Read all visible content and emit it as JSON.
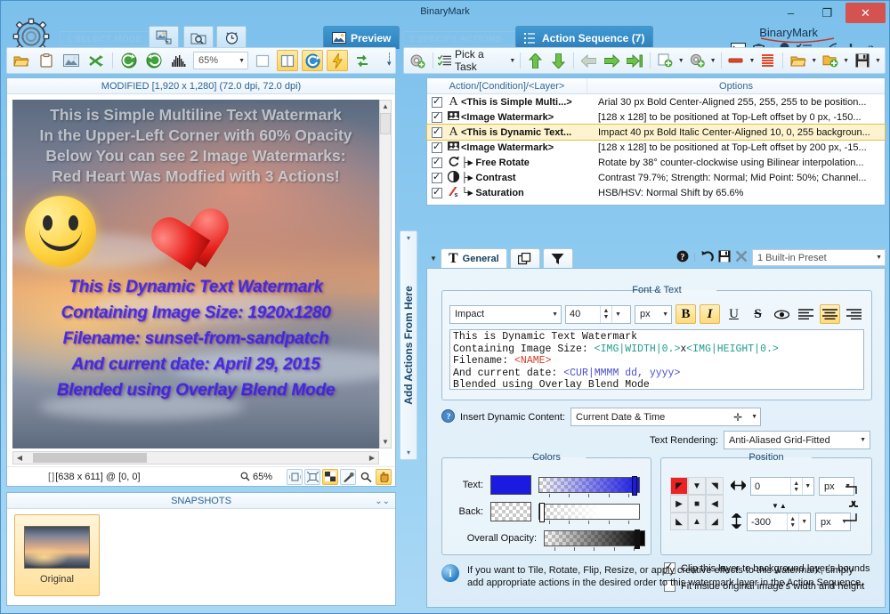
{
  "window": {
    "title": "BinaryMark",
    "brand": "BinaryMark",
    "minimize": "–",
    "maximize": "❐",
    "close": "✕"
  },
  "modebar": {
    "step1_label": "1 SELECT MODE",
    "step2_label": "2 SPECIFY ACTIONS",
    "mode_buttons": [
      {
        "name": "batch-images-mode",
        "icon": "batch-images-icon"
      },
      {
        "name": "folder-watch-mode",
        "icon": "folder-search-icon"
      },
      {
        "name": "scheduler-mode",
        "icon": "alarm-clock-icon"
      }
    ],
    "tabs": [
      {
        "label": "Preview",
        "icon": "picture-icon",
        "active": true
      },
      {
        "label": "Action Sequence (7)",
        "icon": "sequence-icon",
        "active": true
      }
    ],
    "right_icons": [
      "console-icon",
      "shield-icon",
      "lightbulb-icon",
      "checklist-icon",
      "wifi-icon",
      "plus-icon",
      "help-icon"
    ]
  },
  "left_toolbar": {
    "icons": [
      "open-folder-icon",
      "clipboard-icon",
      "image-icon",
      "shuffle-icon",
      "back-icon",
      "forward-icon",
      "histogram-icon"
    ],
    "zoom_value": "65%",
    "right_icons": [
      "single-pane-icon",
      "split-pane-icon",
      "refresh-icon",
      "flash-icon",
      "compare-icon"
    ]
  },
  "right_toolbar": {
    "settings_icon": "settings-gear-icon",
    "pick_task_label": "Pick a Task",
    "icons": [
      "move-up-icon",
      "move-down-icon",
      "nav-left-icon",
      "nav-right-icon",
      "nav-end-icon",
      "add-action-icon",
      "add-layer-icon",
      "remove-icon",
      "list-icon",
      "open-sequence-icon",
      "refresh-sequence-icon",
      "save-sequence-icon"
    ]
  },
  "preview": {
    "header": "MODIFIED [1,920 x 1,280] (72.0 dpi, 72.0 dpi)",
    "watermark_top_lines": [
      "This is Simple Multiline Text Watermark",
      "In the Upper-Left Corner with 60% Opacity",
      "Below You can see 2 Image Watermarks:",
      "Red Heart Was Modfied with 3 Actions!"
    ],
    "watermark_dynamic_lines": [
      "This is Dynamic Text Watermark",
      "Containing Image Size: 1920x1280",
      "Filename: sunset-from-sandpatch",
      "And current date: April 29, 2015",
      "Blended using Overlay Blend Mode"
    ],
    "status_coords": "[638 x 611] @ [0, 0]",
    "status_zoom": "65%",
    "status_tools": [
      "fit-selection-icon",
      "fit-image-icon",
      "transparency-icon",
      "eyedropper-icon",
      "magnifier-icon",
      "pan-hand-icon"
    ]
  },
  "snapshots": {
    "header": "SNAPSHOTS",
    "items": [
      {
        "label": "Original"
      }
    ]
  },
  "vstrip": {
    "label": "Add Actions From Here"
  },
  "sequence": {
    "columns": [
      "Action/[Condition]/<Layer>",
      "Options"
    ],
    "rows": [
      {
        "checked": true,
        "icon": "A",
        "name": "<This is Simple Multi...>",
        "options": "Arial 30 px Bold Center-Aligned 255, 255, 255 to be position...",
        "selected": false
      },
      {
        "checked": true,
        "icon": "img",
        "name": "<Image Watermark>",
        "options": "[128 x 128] to be positioned at Top-Left offset by 0 px, -150...",
        "selected": false
      },
      {
        "checked": true,
        "icon": "A",
        "name": "<This is Dynamic Text...",
        "options": "Impact 40 px Bold Italic Center-Aligned 10, 0, 255 backgroun...",
        "selected": true
      },
      {
        "checked": true,
        "icon": "img",
        "name": "<Image Watermark>",
        "options": "[128 x 128] to be positioned at Top-Left offset by 200 px, -15...",
        "selected": false
      },
      {
        "checked": true,
        "icon": "rotate",
        "name": "├▸ Free Rotate",
        "options": "Rotate by 38° counter-clockwise using Bilinear interpolation...",
        "selected": false
      },
      {
        "checked": true,
        "icon": "contrast",
        "name": "├▸ Contrast",
        "options": "Contrast 79.7%; Strength: Normal; Mid Point: 50%; Channel...",
        "selected": false
      },
      {
        "checked": true,
        "icon": "sat",
        "name": "└▸ Saturation",
        "options": "HSB/HSV: Normal Shift by 65.6%",
        "selected": false
      }
    ]
  },
  "settings_tabs": {
    "tabs": [
      {
        "label": "General",
        "icon": "text-T-icon",
        "active": true
      },
      {
        "label": "",
        "icon": "layers-icon",
        "active": false
      },
      {
        "label": "",
        "icon": "filter-funnel-icon",
        "active": false
      }
    ],
    "tools": [
      "help-icon",
      "undo-icon",
      "save-icon",
      "delete-icon"
    ],
    "preset_value": "1 Built-in Preset"
  },
  "font_text": {
    "legend": "Font & Text",
    "font_family": "Impact",
    "font_size": "40",
    "font_unit": "px",
    "bold": {
      "label": "B",
      "active": true
    },
    "italic": {
      "label": "I",
      "active": true
    },
    "underline": {
      "label": "U",
      "active": false
    },
    "strike": {
      "label": "S",
      "active": false
    },
    "outline_icon": "outline-eye-icon",
    "align_left": {
      "icon": "align-left-icon",
      "active": false
    },
    "align_center": {
      "icon": "align-center-icon",
      "active": true
    },
    "align_right": {
      "icon": "align-right-icon",
      "active": false
    },
    "text_lines": [
      [
        {
          "t": "This is Dynamic Text Watermark",
          "c": "plain"
        }
      ],
      [
        {
          "t": "Containing Image Size: ",
          "c": "plain"
        },
        {
          "t": "<IMG|WIDTH|0.>",
          "c": "img"
        },
        {
          "t": "x",
          "c": "plain"
        },
        {
          "t": "<IMG|HEIGHT|0.>",
          "c": "img"
        }
      ],
      [
        {
          "t": "Filename: ",
          "c": "plain"
        },
        {
          "t": "<NAME>",
          "c": "name"
        }
      ],
      [
        {
          "t": "And current date: ",
          "c": "plain"
        },
        {
          "t": "<CUR|MMMM dd, yyyy>",
          "c": "cur"
        }
      ],
      [
        {
          "t": "Blended using Overlay Blend Mode",
          "c": "plain"
        }
      ]
    ],
    "insert_dynamic_label": "Insert Dynamic Content:",
    "insert_dynamic_value": "Current Date & Time",
    "text_rendering_label": "Text Rendering:",
    "text_rendering_value": "Anti-Aliased Grid-Fitted"
  },
  "colors": {
    "legend": "Colors",
    "text_label": "Text:",
    "text_color": "#1a1ae0",
    "back_label": "Back:",
    "back_color": "transparent",
    "opacity_label": "Overall Opacity:"
  },
  "position": {
    "legend": "Position",
    "anchor_selected": "top-left",
    "x_value": "0",
    "x_unit": "px",
    "y_value": "-300",
    "y_unit": "px",
    "clip_label": "Clip this layer to background layer's bounds",
    "clip_checked": true,
    "fit_label": "Fit inside original image's width and height",
    "fit_checked": false
  },
  "info": {
    "text": "If you want to Tile, Rotate, Flip, Resize, or apply creative effects to this watermark, simply add appropriate actions in the desired order to this watermark layer in the Action Sequence."
  }
}
